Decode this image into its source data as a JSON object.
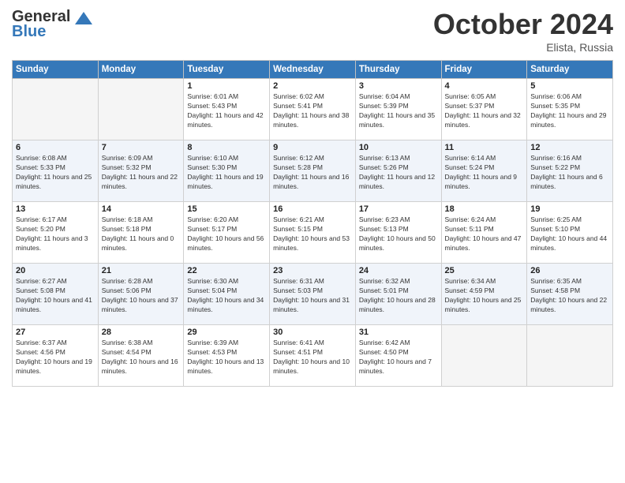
{
  "logo": {
    "line1": "General",
    "line2": "Blue"
  },
  "title": "October 2024",
  "location": "Elista, Russia",
  "weekdays": [
    "Sunday",
    "Monday",
    "Tuesday",
    "Wednesday",
    "Thursday",
    "Friday",
    "Saturday"
  ],
  "weeks": [
    [
      {
        "day": "",
        "info": ""
      },
      {
        "day": "",
        "info": ""
      },
      {
        "day": "1",
        "info": "Sunrise: 6:01 AM\nSunset: 5:43 PM\nDaylight: 11 hours and 42 minutes."
      },
      {
        "day": "2",
        "info": "Sunrise: 6:02 AM\nSunset: 5:41 PM\nDaylight: 11 hours and 38 minutes."
      },
      {
        "day": "3",
        "info": "Sunrise: 6:04 AM\nSunset: 5:39 PM\nDaylight: 11 hours and 35 minutes."
      },
      {
        "day": "4",
        "info": "Sunrise: 6:05 AM\nSunset: 5:37 PM\nDaylight: 11 hours and 32 minutes."
      },
      {
        "day": "5",
        "info": "Sunrise: 6:06 AM\nSunset: 5:35 PM\nDaylight: 11 hours and 29 minutes."
      }
    ],
    [
      {
        "day": "6",
        "info": "Sunrise: 6:08 AM\nSunset: 5:33 PM\nDaylight: 11 hours and 25 minutes."
      },
      {
        "day": "7",
        "info": "Sunrise: 6:09 AM\nSunset: 5:32 PM\nDaylight: 11 hours and 22 minutes."
      },
      {
        "day": "8",
        "info": "Sunrise: 6:10 AM\nSunset: 5:30 PM\nDaylight: 11 hours and 19 minutes."
      },
      {
        "day": "9",
        "info": "Sunrise: 6:12 AM\nSunset: 5:28 PM\nDaylight: 11 hours and 16 minutes."
      },
      {
        "day": "10",
        "info": "Sunrise: 6:13 AM\nSunset: 5:26 PM\nDaylight: 11 hours and 12 minutes."
      },
      {
        "day": "11",
        "info": "Sunrise: 6:14 AM\nSunset: 5:24 PM\nDaylight: 11 hours and 9 minutes."
      },
      {
        "day": "12",
        "info": "Sunrise: 6:16 AM\nSunset: 5:22 PM\nDaylight: 11 hours and 6 minutes."
      }
    ],
    [
      {
        "day": "13",
        "info": "Sunrise: 6:17 AM\nSunset: 5:20 PM\nDaylight: 11 hours and 3 minutes."
      },
      {
        "day": "14",
        "info": "Sunrise: 6:18 AM\nSunset: 5:18 PM\nDaylight: 11 hours and 0 minutes."
      },
      {
        "day": "15",
        "info": "Sunrise: 6:20 AM\nSunset: 5:17 PM\nDaylight: 10 hours and 56 minutes."
      },
      {
        "day": "16",
        "info": "Sunrise: 6:21 AM\nSunset: 5:15 PM\nDaylight: 10 hours and 53 minutes."
      },
      {
        "day": "17",
        "info": "Sunrise: 6:23 AM\nSunset: 5:13 PM\nDaylight: 10 hours and 50 minutes."
      },
      {
        "day": "18",
        "info": "Sunrise: 6:24 AM\nSunset: 5:11 PM\nDaylight: 10 hours and 47 minutes."
      },
      {
        "day": "19",
        "info": "Sunrise: 6:25 AM\nSunset: 5:10 PM\nDaylight: 10 hours and 44 minutes."
      }
    ],
    [
      {
        "day": "20",
        "info": "Sunrise: 6:27 AM\nSunset: 5:08 PM\nDaylight: 10 hours and 41 minutes."
      },
      {
        "day": "21",
        "info": "Sunrise: 6:28 AM\nSunset: 5:06 PM\nDaylight: 10 hours and 37 minutes."
      },
      {
        "day": "22",
        "info": "Sunrise: 6:30 AM\nSunset: 5:04 PM\nDaylight: 10 hours and 34 minutes."
      },
      {
        "day": "23",
        "info": "Sunrise: 6:31 AM\nSunset: 5:03 PM\nDaylight: 10 hours and 31 minutes."
      },
      {
        "day": "24",
        "info": "Sunrise: 6:32 AM\nSunset: 5:01 PM\nDaylight: 10 hours and 28 minutes."
      },
      {
        "day": "25",
        "info": "Sunrise: 6:34 AM\nSunset: 4:59 PM\nDaylight: 10 hours and 25 minutes."
      },
      {
        "day": "26",
        "info": "Sunrise: 6:35 AM\nSunset: 4:58 PM\nDaylight: 10 hours and 22 minutes."
      }
    ],
    [
      {
        "day": "27",
        "info": "Sunrise: 6:37 AM\nSunset: 4:56 PM\nDaylight: 10 hours and 19 minutes."
      },
      {
        "day": "28",
        "info": "Sunrise: 6:38 AM\nSunset: 4:54 PM\nDaylight: 10 hours and 16 minutes."
      },
      {
        "day": "29",
        "info": "Sunrise: 6:39 AM\nSunset: 4:53 PM\nDaylight: 10 hours and 13 minutes."
      },
      {
        "day": "30",
        "info": "Sunrise: 6:41 AM\nSunset: 4:51 PM\nDaylight: 10 hours and 10 minutes."
      },
      {
        "day": "31",
        "info": "Sunrise: 6:42 AM\nSunset: 4:50 PM\nDaylight: 10 hours and 7 minutes."
      },
      {
        "day": "",
        "info": ""
      },
      {
        "day": "",
        "info": ""
      }
    ]
  ]
}
